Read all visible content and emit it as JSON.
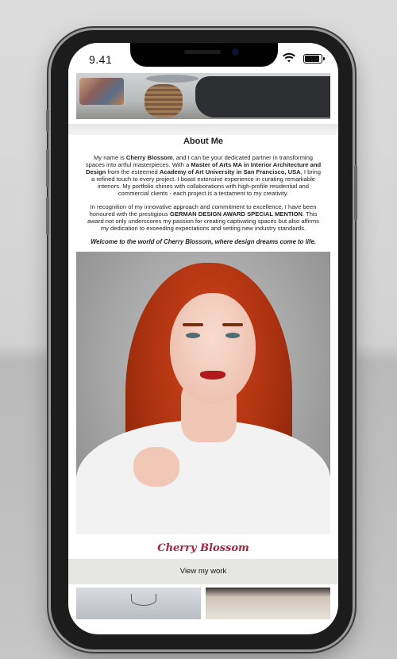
{
  "status_bar": {
    "time": "9.41"
  },
  "about": {
    "title": "About Me",
    "paragraph1": {
      "p1": "My name is ",
      "name": "Cherry Blossom",
      "p2": ", and I can be your dedicated partner in transforming spaces into artful masterpieces. With a ",
      "degree": "Master of Arts MA in Interior Architecture and Design",
      "p3": " from the esteemed ",
      "school": "Academy of Art University in San Francisco, USA",
      "p4": ", I bring a refined touch to every project. I boast extensive experience in curating remarkable interiors. My portfolio shines with collaborations with high-profile residential and commercial clients - each project is a testament to my creativity."
    },
    "paragraph2": {
      "p1": "In recognition of my innovative approach and commitment to excellence, I have been honoured with the prestigious ",
      "award": "GERMAN DESIGN AWARD SPECIAL MENTION",
      "p2": ". This award not only underscores my passion for creating captivating spaces but also affirms my dedication to exceeding expectations and setting new industry standards."
    },
    "quote": "Welcome to the world of Cherry Blossom, where design dreams come to life."
  },
  "signature": "Cherry Blossom",
  "cta": {
    "view_work_label": "View my work"
  },
  "colors": {
    "signature": "#a3263f",
    "button_bg": "#e6e6e2"
  }
}
